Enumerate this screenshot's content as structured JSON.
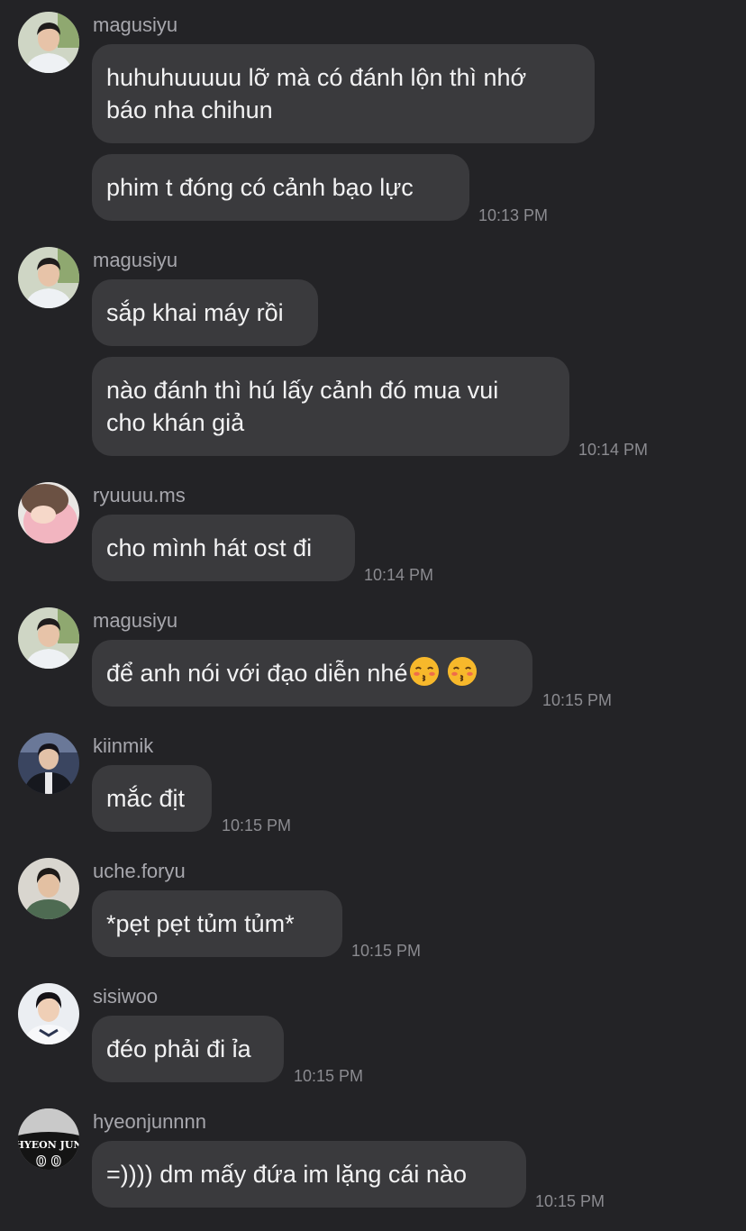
{
  "messages": [
    {
      "username": "magusiyu",
      "bubbles": [
        "huhuhuuuuu lỡ mà có đánh lộn thì nhớ\nbáo nha chihun",
        "phim t đóng có cảnh bạo lực"
      ],
      "time": "10:13 PM"
    },
    {
      "username": "magusiyu",
      "bubbles": [
        "sắp khai máy rồi",
        "nào đánh thì hú lấy cảnh đó mua vui\ncho khán giả"
      ],
      "time": "10:14 PM"
    },
    {
      "username": "ryuuuu.ms",
      "bubbles": [
        "cho mình hát ost đi"
      ],
      "time": "10:14 PM"
    },
    {
      "username": "magusiyu",
      "bubbles": [
        "để anh nói với đạo diễn nhé"
      ],
      "emoji": "kissing-face-closed-eyes-emoji",
      "time": "10:15 PM"
    },
    {
      "username": "kiinmik",
      "bubbles": [
        "mắc địt"
      ],
      "time": "10:15 PM"
    },
    {
      "username": "uche.foryu",
      "bubbles": [
        "*pẹt pẹt tủm tủm*"
      ],
      "time": "10:15 PM"
    },
    {
      "username": "sisiwoo",
      "bubbles": [
        "đéo phải đi ỉa"
      ],
      "time": "10:15 PM"
    },
    {
      "username": "hyeonjunnnn",
      "bubbles": [
        "=)))) dm mấy đứa im lặng cái nào"
      ],
      "time": "10:15 PM",
      "avatar_text": "HYEON JUN"
    }
  ],
  "colors": {
    "background": "#232326",
    "bubble": "#3a3a3d",
    "text": "#f2f2f3",
    "username": "#a7a7ad",
    "timestamp": "#8b8b90"
  }
}
